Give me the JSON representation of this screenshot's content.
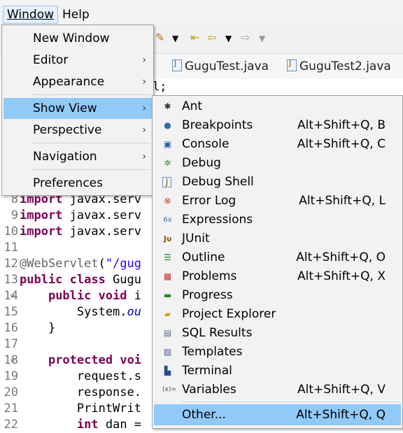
{
  "menubar": {
    "window": "Window",
    "help": "Help"
  },
  "tabs": [
    {
      "label": "GuguTest.java"
    },
    {
      "label": "GuguTest2.java"
    }
  ],
  "editor": {
    "lines": [
      {
        "num": "8",
        "code": "import javax.serv"
      },
      {
        "num": "9",
        "code": "import javax.serv"
      },
      {
        "num": "10",
        "code": "import javax.serv"
      },
      {
        "num": "11",
        "code": ""
      },
      {
        "num": "12",
        "code": "@WebServlet(\"/gug"
      },
      {
        "num": "13",
        "code": "public class Gugu"
      },
      {
        "num": "14",
        "code": "    public void i"
      },
      {
        "num": "15",
        "code": "        System.ou"
      },
      {
        "num": "16",
        "code": "    }"
      },
      {
        "num": "17",
        "code": ""
      },
      {
        "num": "18",
        "code": "    protected voi"
      },
      {
        "num": "19",
        "code": "        request.s"
      },
      {
        "num": "20",
        "code": "        response."
      },
      {
        "num": "21",
        "code": "        PrintWrit"
      },
      {
        "num": "22",
        "code": "        int dan ="
      }
    ],
    "top_fragment": "l;"
  },
  "window_menu": {
    "items": [
      {
        "label": "New Window",
        "submenu": false
      },
      {
        "label": "Editor",
        "submenu": true
      },
      {
        "label": "Appearance",
        "submenu": true
      },
      {
        "label": "Show View",
        "submenu": true,
        "selected": true
      },
      {
        "label": "Perspective",
        "submenu": true
      },
      {
        "label": "Navigation",
        "submenu": true
      },
      {
        "label": "Preferences",
        "submenu": false
      }
    ]
  },
  "show_view_menu": {
    "items": [
      {
        "label": "Ant",
        "shortcut": "",
        "icon": "ant-icon"
      },
      {
        "label": "Breakpoints",
        "shortcut": "Alt+Shift+Q, B",
        "icon": "breakpoints-icon"
      },
      {
        "label": "Console",
        "shortcut": "Alt+Shift+Q, C",
        "icon": "console-icon"
      },
      {
        "label": "Debug",
        "shortcut": "",
        "icon": "debug-icon"
      },
      {
        "label": "Debug Shell",
        "shortcut": "",
        "icon": "debug-shell-icon"
      },
      {
        "label": "Error Log",
        "shortcut": "Alt+Shift+Q, L",
        "icon": "error-log-icon"
      },
      {
        "label": "Expressions",
        "shortcut": "",
        "icon": "expressions-icon"
      },
      {
        "label": "JUnit",
        "shortcut": "",
        "icon": "junit-icon"
      },
      {
        "label": "Outline",
        "shortcut": "Alt+Shift+Q, O",
        "icon": "outline-icon"
      },
      {
        "label": "Problems",
        "shortcut": "Alt+Shift+Q, X",
        "icon": "problems-icon"
      },
      {
        "label": "Progress",
        "shortcut": "",
        "icon": "progress-icon"
      },
      {
        "label": "Project Explorer",
        "shortcut": "",
        "icon": "project-explorer-icon"
      },
      {
        "label": "SQL Results",
        "shortcut": "",
        "icon": "sql-results-icon"
      },
      {
        "label": "Templates",
        "shortcut": "",
        "icon": "templates-icon"
      },
      {
        "label": "Terminal",
        "shortcut": "",
        "icon": "terminal-icon"
      },
      {
        "label": "Variables",
        "shortcut": "Alt+Shift+Q, V",
        "icon": "variables-icon"
      }
    ],
    "other": {
      "label": "Other...",
      "shortcut": "Alt+Shift+Q, Q"
    }
  }
}
